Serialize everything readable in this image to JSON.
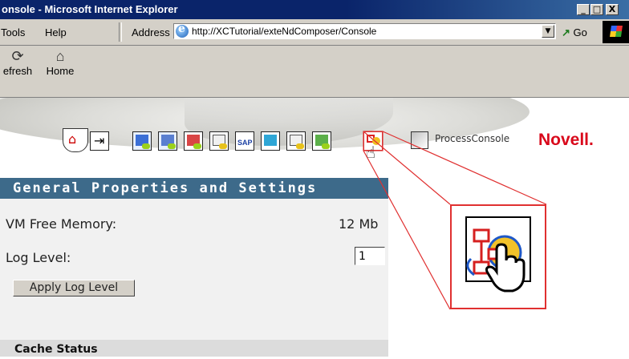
{
  "window": {
    "title": "onsole - Microsoft Internet Explorer",
    "controls": [
      "_",
      "□",
      "X"
    ]
  },
  "menubar": {
    "items": [
      "Tools",
      "Help"
    ],
    "address_label": "Address",
    "url": "http://XCTutorial/exteNdComposer/Console",
    "go_label": "Go"
  },
  "toolbar": {
    "buttons": [
      {
        "label": "efresh",
        "icon": "refresh-icon"
      },
      {
        "label": "Home",
        "icon": "home-icon"
      }
    ]
  },
  "banner": {
    "process_console_label": "ProcessConsole",
    "brand": "Novell."
  },
  "settings": {
    "section_title": "General Properties and Settings",
    "vm_free_memory_label": "VM Free Memory:",
    "vm_free_memory_value": "12 Mb",
    "log_level_label": "Log Level:",
    "log_level_value": "1",
    "apply_button_label": "Apply Log Level",
    "cache_status_label": "Cache Status"
  },
  "colors": {
    "title_bar": "#0a246a",
    "section_header": "#3d6a8a",
    "brand_red": "#d9081b",
    "callout_red": "#e03030"
  }
}
